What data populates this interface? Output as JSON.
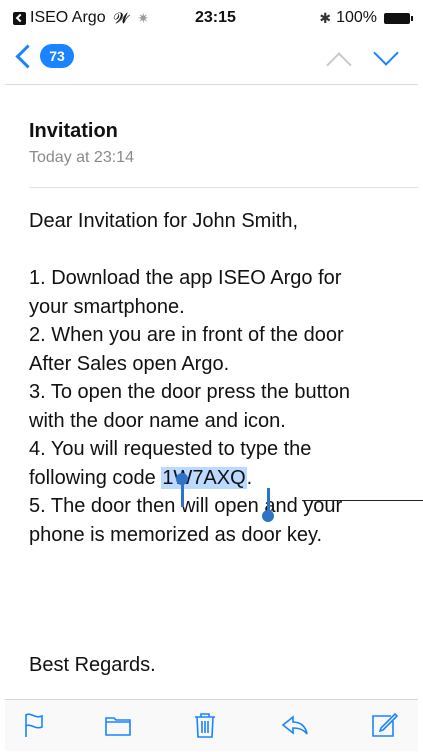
{
  "status_bar": {
    "back_app_label": "ISEO Argo",
    "time": "23:15",
    "battery": "100%"
  },
  "nav": {
    "back_count": "73"
  },
  "email": {
    "subject": "Invitation",
    "date": "Today at 23:14",
    "greeting": "Dear Invitation for John Smith,",
    "lines": [
      "1. Download the app ISEO Argo for",
      "your smartphone.",
      "2. When you are in front of the door",
      "After Sales open Argo.",
      "3. To open the door press the button",
      "with the door name and icon.",
      "4. You will requested to type the"
    ],
    "code_prefix": "following code ",
    "code": "1W7AXQ",
    "code_suffix": ".",
    "after_lines": [
      "5. The door then will open and your",
      "phone is memorized as door key."
    ],
    "sign_off": "Best Regards."
  },
  "toolbar": {
    "icons": [
      "flag-icon",
      "folder-icon",
      "trash-icon",
      "reply-icon",
      "compose-icon"
    ]
  },
  "colors": {
    "accent": "#1a84ff",
    "selection": "#bcd9ff",
    "handle": "#2f73c9"
  }
}
